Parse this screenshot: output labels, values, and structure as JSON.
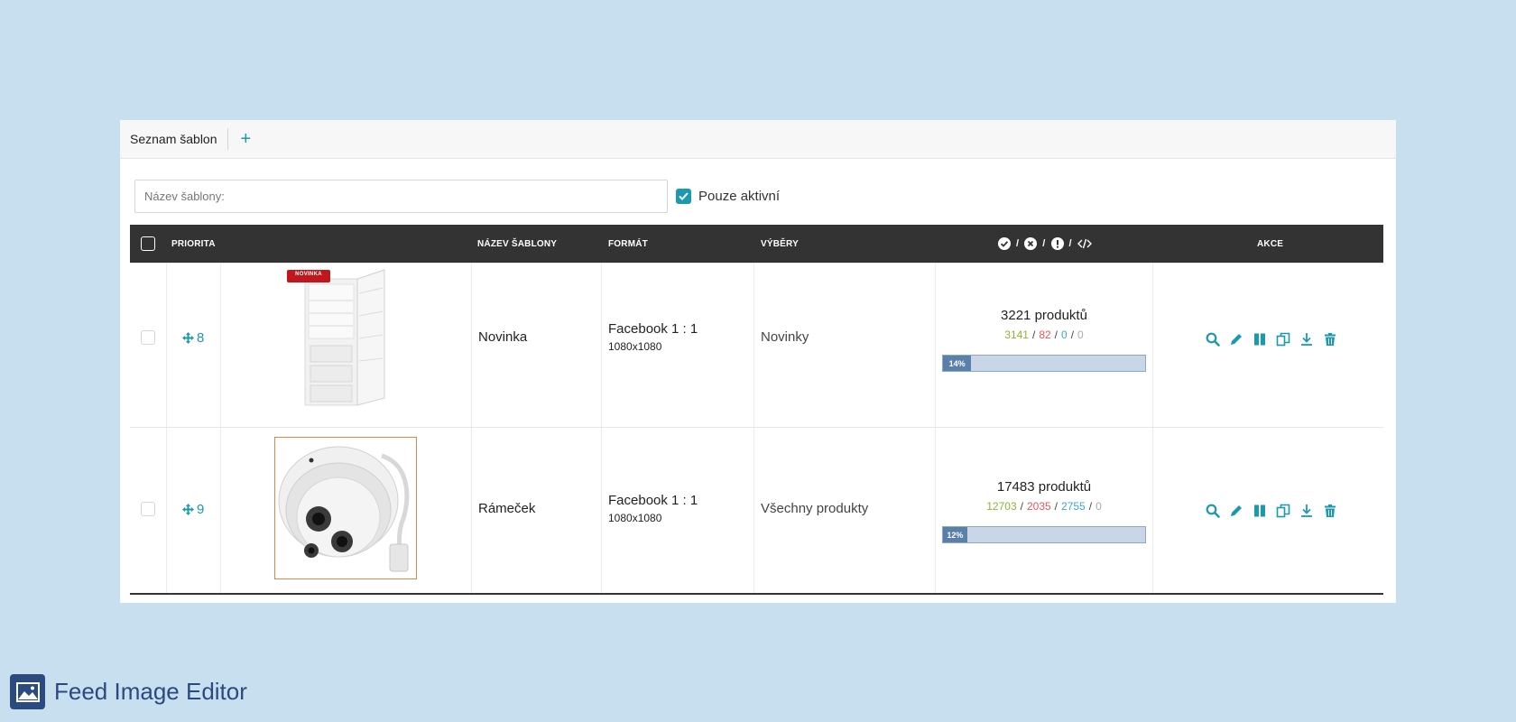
{
  "tabs": {
    "list_label": "Seznam šablon",
    "add_label": "+"
  },
  "filters": {
    "name_placeholder": "Název šablony:",
    "active_label": "Pouze aktivní",
    "active_checked": true
  },
  "table": {
    "headers": {
      "priority": "PRIORITA",
      "name": "NÁZEV ŠABLONY",
      "format": "FORMÁT",
      "selection": "VÝBĚRY",
      "actions": "AKCE"
    },
    "status_icons": [
      "check-circle-icon",
      "x-circle-icon",
      "exclamation-circle-icon",
      "code-icon"
    ],
    "rows": [
      {
        "priority": "8",
        "image": "refrigerator",
        "badge": "NOVINKA",
        "name": "Novinka",
        "format": "Facebook 1 : 1",
        "size": "1080x1080",
        "selection": "Novinky",
        "count": "3221 produktů",
        "ok": "3141",
        "errors": "82",
        "warnings": "0",
        "code": "0",
        "progress_label": "14%",
        "progress": 0.14
      },
      {
        "priority": "9",
        "image": "security-camera",
        "badge": "",
        "name": "Rámeček",
        "format": "Facebook 1 : 1",
        "size": "1080x1080",
        "selection": "Všechny produkty",
        "count": "17483 produktů",
        "ok": "12703",
        "errors": "2035",
        "warnings": "2755",
        "code": "0",
        "progress_label": "12%",
        "progress": 0.12
      }
    ],
    "action_icons": [
      "search-icon",
      "pencil-icon",
      "pause-icon",
      "copy-icon",
      "download-icon",
      "trash-icon"
    ]
  },
  "colors": {
    "accent": "#1a9ab0",
    "header_bg": "#333333",
    "background": "#c8dff0",
    "ok": "#8ab832",
    "error": "#e8545a",
    "warning": "#3aa8c8"
  },
  "brand": {
    "name": "Feed Image Editor"
  }
}
